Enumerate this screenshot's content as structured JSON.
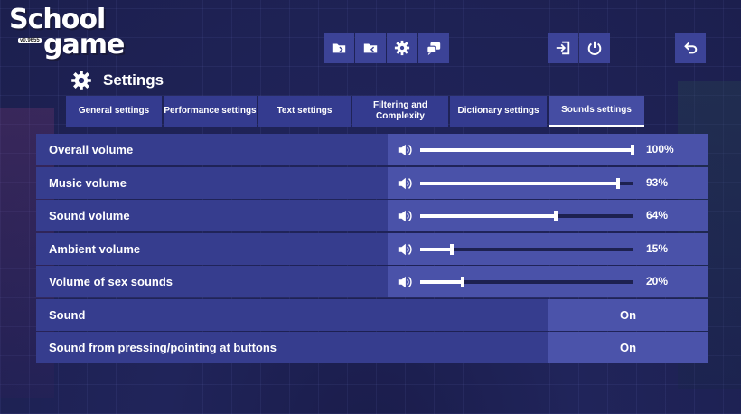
{
  "logo": {
    "line1": "School",
    "line2": "game",
    "version": "v0.9655"
  },
  "toolbar": {
    "icons": [
      "folder-save-icon",
      "folder-load-icon",
      "gear-icon",
      "chat-icon",
      "exit-icon",
      "power-icon",
      "back-icon"
    ]
  },
  "header": {
    "title": "Settings"
  },
  "tabs": [
    {
      "label": "General settings",
      "active": false
    },
    {
      "label": "Performance settings",
      "active": false
    },
    {
      "label": "Text settings",
      "active": false
    },
    {
      "label": "Filtering and Complexity",
      "active": false
    },
    {
      "label": "Dictionary settings",
      "active": false
    },
    {
      "label": "Sounds settings",
      "active": true
    }
  ],
  "volumes": [
    {
      "label": "Overall volume",
      "value": 100,
      "display": "100%"
    },
    {
      "label": "Music volume",
      "value": 93,
      "display": "93%"
    },
    {
      "label": "Sound volume",
      "value": 64,
      "display": "64%"
    },
    {
      "label": "Ambient volume",
      "value": 15,
      "display": "15%"
    },
    {
      "label": "Volume of sex sounds",
      "value": 20,
      "display": "20%"
    }
  ],
  "toggles": [
    {
      "label": "Sound",
      "value": "On"
    },
    {
      "label": "Sound from pressing/pointing at buttons",
      "value": "On"
    }
  ],
  "colors": {
    "panel": "#363d8e",
    "control": "#4a52a9",
    "track": "#1d2150",
    "accent": "#ffffff"
  }
}
